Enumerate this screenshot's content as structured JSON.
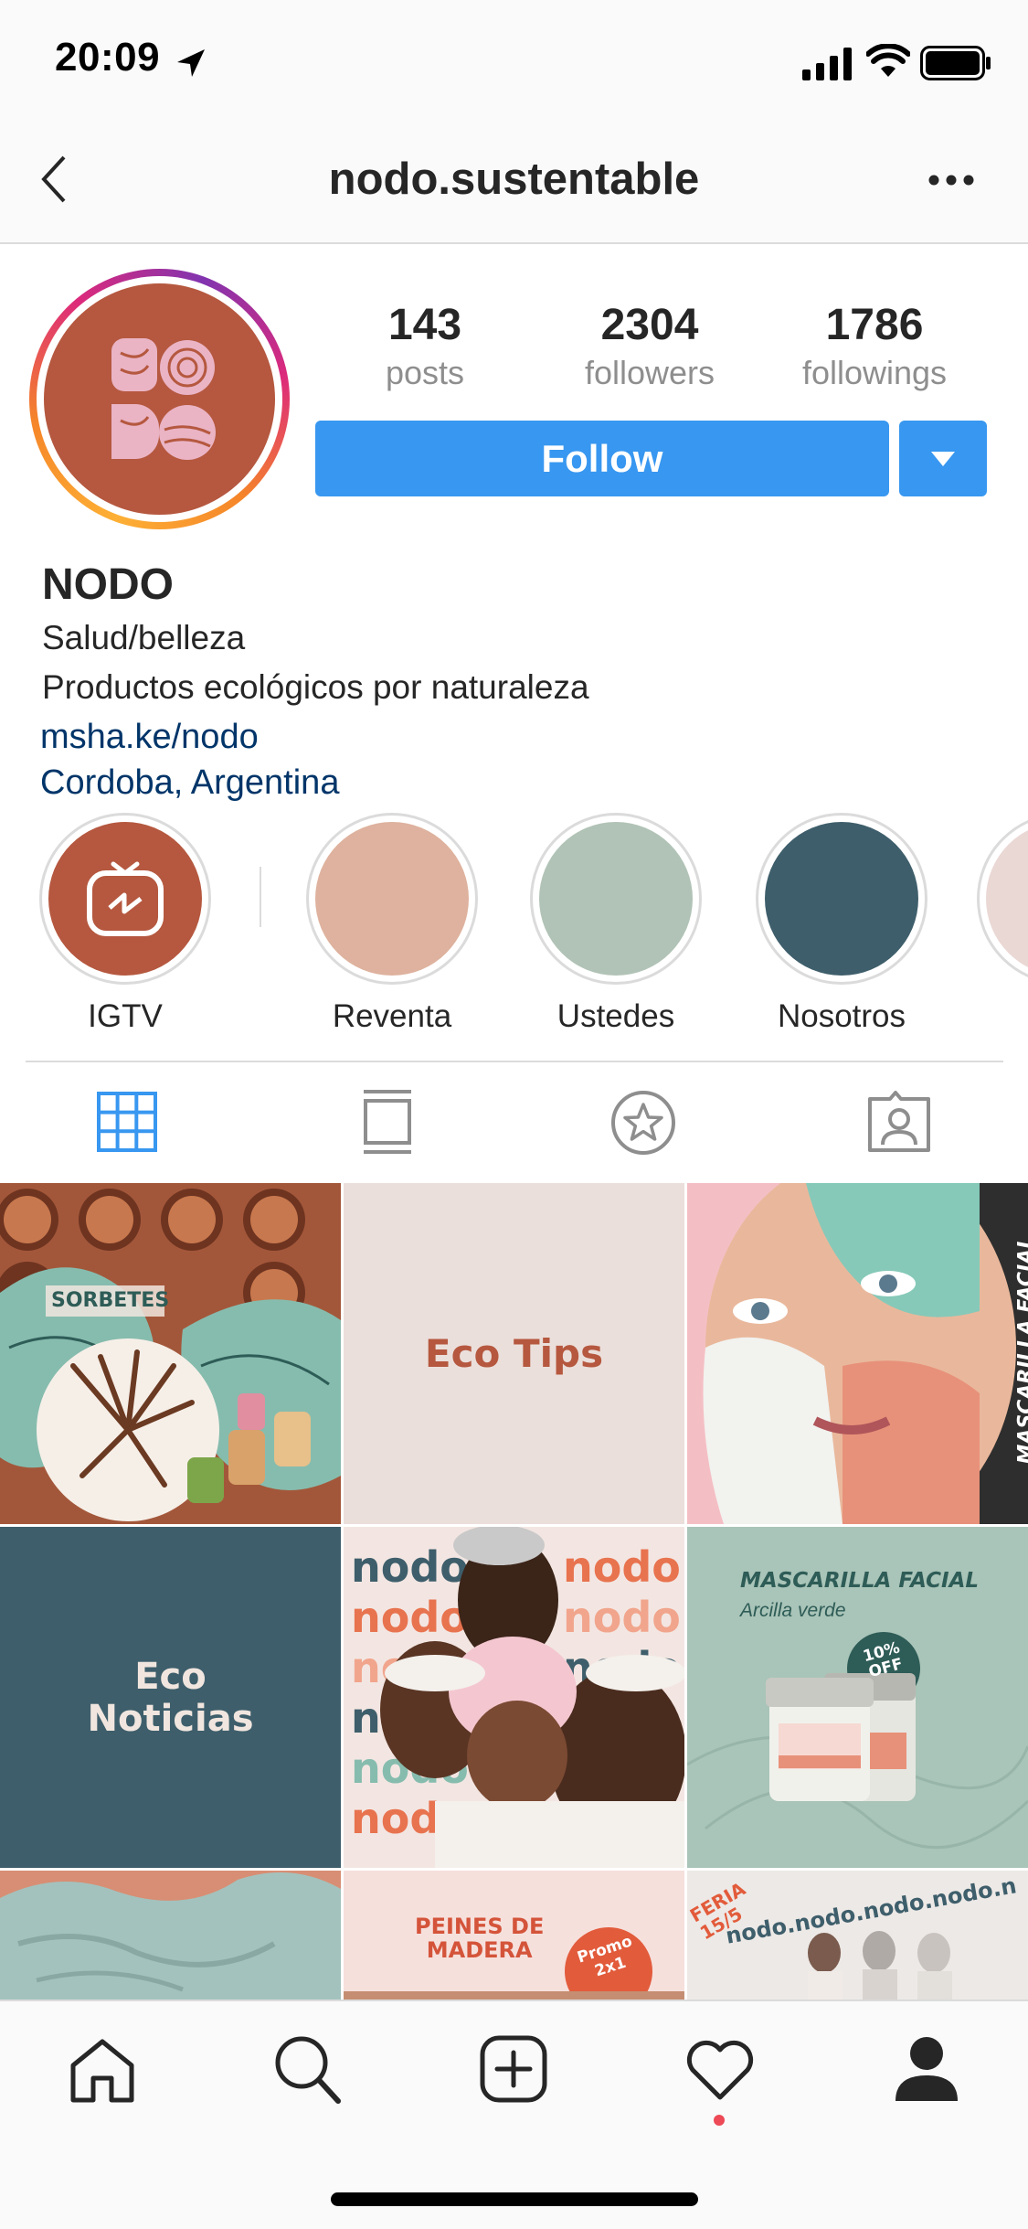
{
  "status": {
    "time": "20:09"
  },
  "header": {
    "username": "nodo.sustentable"
  },
  "profile": {
    "avatar_text": "NODO",
    "stats": [
      {
        "value": "143",
        "label": "posts"
      },
      {
        "value": "2304",
        "label": "followers"
      },
      {
        "value": "1786",
        "label": "followings"
      }
    ],
    "follow_label": "Follow",
    "name": "NODO",
    "category": "Salud/belleza",
    "bio": "Productos ecológicos por naturaleza",
    "link": "msha.ke/nodo",
    "location": "Cordoba, Argentina"
  },
  "highlights": [
    {
      "label": "IGTV",
      "color": "#b5583f"
    },
    {
      "label": "Reventa",
      "color": "#deb29e"
    },
    {
      "label": "Ustedes",
      "color": "#b1c3b6"
    },
    {
      "label": "Nosotros",
      "color": "#3e5e6b"
    },
    {
      "label": "",
      "color": "#ead8d5"
    }
  ],
  "tabs": [
    "grid-icon",
    "feed-icon",
    "star-icon",
    "tagged-icon"
  ],
  "posts": {
    "p1": {
      "label": "SORBETES"
    },
    "p2": {
      "label": "Eco Tips"
    },
    "p3": {
      "label": "MASCARILLA FACIAL"
    },
    "p4": {
      "line1": "Eco",
      "line2": "Noticias"
    },
    "p5": {
      "label": "nodo"
    },
    "p6": {
      "title": "MASCARILLA FACIAL",
      "subtitle": "Arcilla verde",
      "badge1": "10%",
      "badge2": "OFF"
    },
    "p8": {
      "line1": "PEINES DE",
      "line2": "MADERA",
      "badge1": "Promo",
      "badge2": "2x1"
    },
    "p9": {
      "label": "nodo.nodo.nodo.nodo.n",
      "badge1": "FERIA",
      "badge2": "15/5"
    }
  },
  "colors": {
    "accent": "#3897f0",
    "brand": "#b5583f"
  }
}
